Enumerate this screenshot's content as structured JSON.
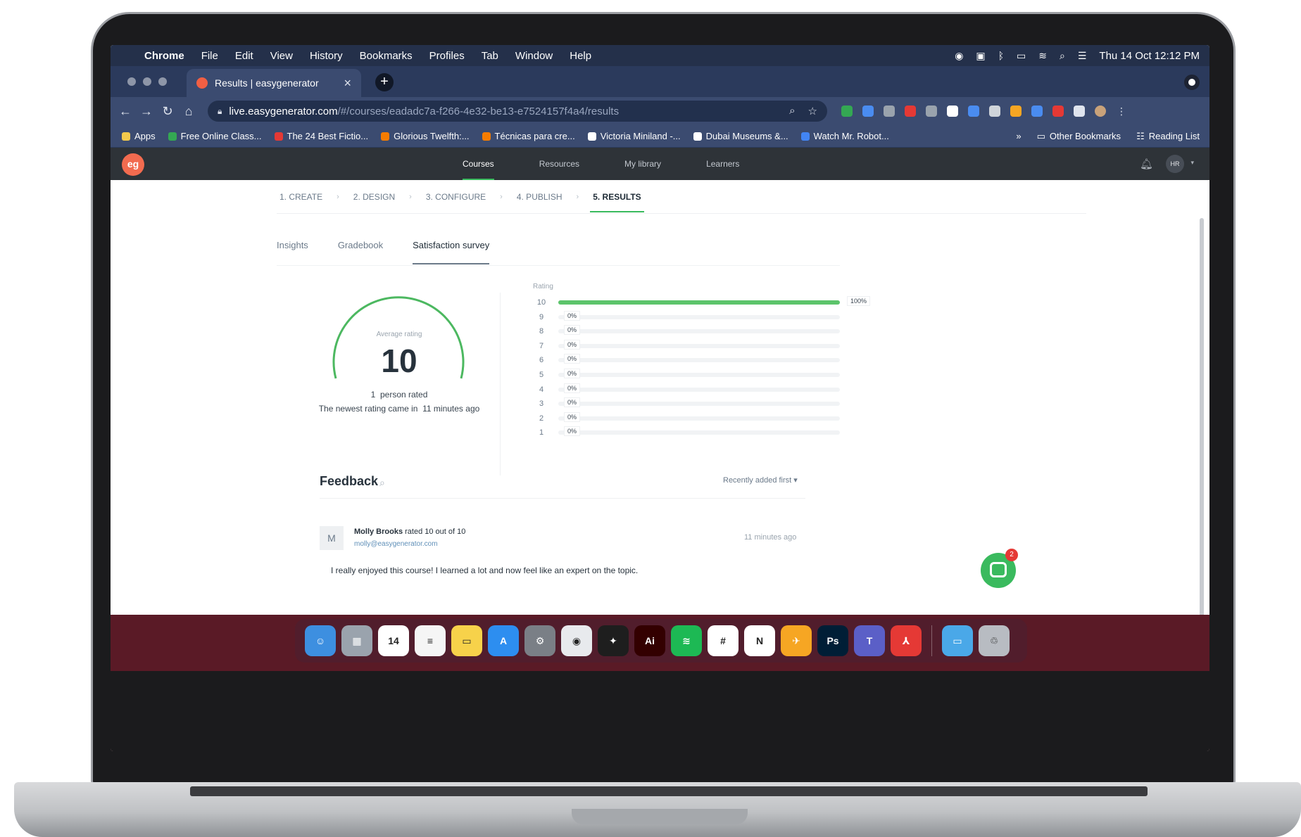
{
  "menubar": {
    "app": "Chrome",
    "items": [
      "File",
      "Edit",
      "View",
      "History",
      "Bookmarks",
      "Profiles",
      "Tab",
      "Window",
      "Help"
    ],
    "clock": "Thu 14 Oct  12:12 PM"
  },
  "browser": {
    "tab_title": "Results | easygenerator",
    "url_host": "live.easygenerator.com",
    "url_path": "/#/courses/eadadc7a-f266-4e32-be13-e7524157f4a4/results",
    "bookmarks": [
      {
        "label": "Apps",
        "color": "#f2c94c"
      },
      {
        "label": "Free Online Class...",
        "color": "#34a853"
      },
      {
        "label": "The 24 Best Fictio...",
        "color": "#e53935"
      },
      {
        "label": "Glorious Twelfth:...",
        "color": "#f57c00"
      },
      {
        "label": "Técnicas para cre...",
        "color": "#f57c00"
      },
      {
        "label": "Victoria Miniland -...",
        "color": "#ffffff"
      },
      {
        "label": "Dubai Museums &...",
        "color": "#ffffff"
      },
      {
        "label": "Watch Mr. Robot...",
        "color": "#4285f4"
      }
    ],
    "more": "»",
    "other_bookmarks": "Other Bookmarks",
    "reading_list": "Reading List"
  },
  "app": {
    "logo": "eg",
    "nav": [
      "Courses",
      "Resources",
      "My library",
      "Learners"
    ],
    "avatar": "HR",
    "steps": [
      "1. CREATE",
      "2. DESIGN",
      "3. CONFIGURE",
      "4. PUBLISH",
      "5. RESULTS"
    ],
    "subtabs": [
      "Insights",
      "Gradebook",
      "Satisfaction survey"
    ]
  },
  "survey": {
    "average_caption": "Average rating",
    "average_value": "10",
    "rated_count": "1",
    "rated_text": "person rated",
    "newest_prefix": "The newest rating came in",
    "newest_time": "11 minutes ago",
    "rating_title": "Rating"
  },
  "chart_data": {
    "type": "bar",
    "orientation": "horizontal",
    "title": "Rating",
    "categories": [
      "10",
      "9",
      "8",
      "7",
      "6",
      "5",
      "4",
      "3",
      "2",
      "1"
    ],
    "values": [
      100,
      0,
      0,
      0,
      0,
      0,
      0,
      0,
      0,
      0
    ],
    "value_labels": [
      "100%",
      "0%",
      "0%",
      "0%",
      "0%",
      "0%",
      "0%",
      "0%",
      "0%",
      "0%"
    ],
    "unit": "%",
    "xlim": [
      0,
      100
    ],
    "bar_color": "#5cc46b"
  },
  "feedback": {
    "title": "Feedback",
    "sort_label": "Recently added first",
    "entry": {
      "initial": "M",
      "name": "Molly Brooks",
      "rated_text": "rated 10 out of 10",
      "email": "molly@easygenerator.com",
      "time": "11 minutes ago",
      "comment": "I really enjoyed this course! I learned a lot and now feel like an expert on the topic."
    }
  },
  "chat_badge": "2",
  "dock": [
    {
      "name": "finder",
      "label": "☺",
      "color": "#3d8fe0"
    },
    {
      "name": "launchpad",
      "label": "▦",
      "color": "#9aa3ad"
    },
    {
      "name": "calendar",
      "label": "14",
      "color": "#ffffff"
    },
    {
      "name": "reminders",
      "label": "≡",
      "color": "#f5f5f5"
    },
    {
      "name": "notes",
      "label": "▭",
      "color": "#f7d24a"
    },
    {
      "name": "app-store",
      "label": "A",
      "color": "#2d8ef0"
    },
    {
      "name": "system-preferences",
      "label": "⚙",
      "color": "#7a7f86"
    },
    {
      "name": "chrome",
      "label": "◉",
      "color": "#e8eaed"
    },
    {
      "name": "figma",
      "label": "✦",
      "color": "#1e1e1e"
    },
    {
      "name": "illustrator",
      "label": "Ai",
      "color": "#330000"
    },
    {
      "name": "spotify",
      "label": "≋",
      "color": "#1db954"
    },
    {
      "name": "slack",
      "label": "#",
      "color": "#ffffff"
    },
    {
      "name": "notion",
      "label": "N",
      "color": "#ffffff"
    },
    {
      "name": "transmit",
      "label": "✈",
      "color": "#f6a623"
    },
    {
      "name": "photoshop",
      "label": "Ps",
      "color": "#001e36"
    },
    {
      "name": "teams",
      "label": "T",
      "color": "#5b5fc7"
    },
    {
      "name": "acrobat",
      "label": "⅄",
      "color": "#e53935"
    },
    {
      "name": "downloads",
      "label": "▭",
      "color": "#4aa8e8"
    },
    {
      "name": "trash",
      "label": "♲",
      "color": "#b8bcc2"
    }
  ]
}
